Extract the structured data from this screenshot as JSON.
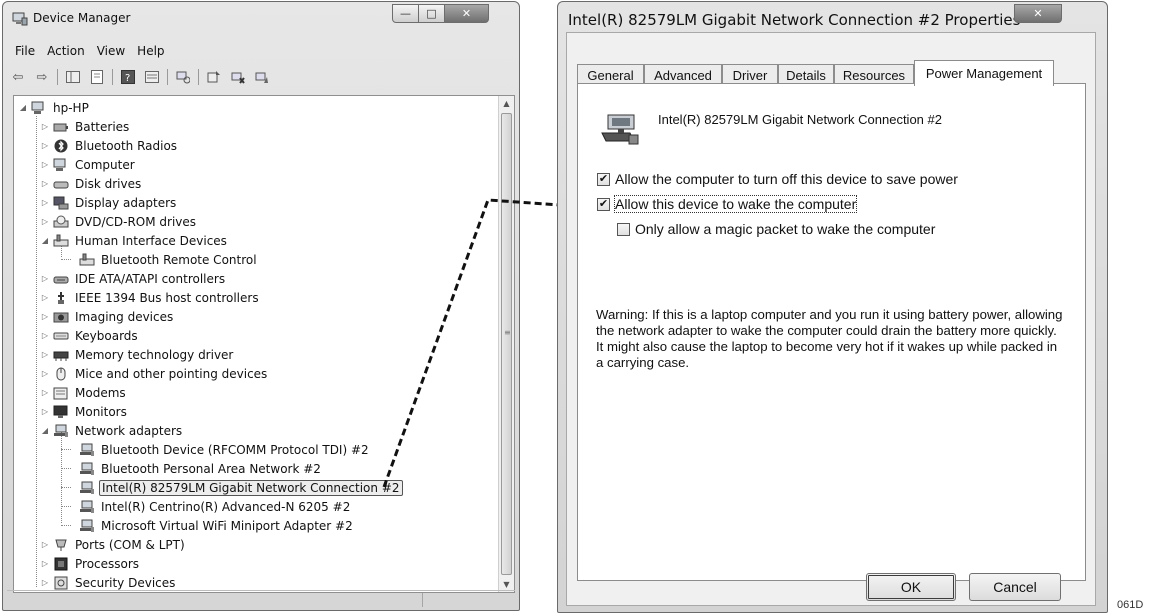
{
  "device_manager": {
    "title": "Device Manager",
    "menu": [
      "File",
      "Action",
      "View",
      "Help"
    ],
    "tree": [
      {
        "label": "hp-HP",
        "icon": "computer-icon",
        "level": 0,
        "expanded": true
      },
      {
        "label": "Batteries",
        "icon": "battery-icon",
        "level": 1,
        "expanded": false
      },
      {
        "label": "Bluetooth Radios",
        "icon": "bluetooth-icon",
        "level": 1,
        "expanded": false
      },
      {
        "label": "Computer",
        "icon": "computer-icon",
        "level": 1,
        "expanded": false
      },
      {
        "label": "Disk drives",
        "icon": "disk-drive-icon",
        "level": 1,
        "expanded": false
      },
      {
        "label": "Display adapters",
        "icon": "display-adapter-icon",
        "level": 1,
        "expanded": false
      },
      {
        "label": "DVD/CD-ROM drives",
        "icon": "dvd-drive-icon",
        "level": 1,
        "expanded": false
      },
      {
        "label": "Human Interface Devices",
        "icon": "hid-icon",
        "level": 1,
        "expanded": true
      },
      {
        "label": "Bluetooth Remote Control",
        "icon": "hid-icon",
        "level": 2
      },
      {
        "label": "IDE ATA/ATAPI controllers",
        "icon": "ide-controller-icon",
        "level": 1,
        "expanded": false
      },
      {
        "label": "IEEE 1394 Bus host controllers",
        "icon": "firewire-icon",
        "level": 1,
        "expanded": false
      },
      {
        "label": "Imaging devices",
        "icon": "camera-icon",
        "level": 1,
        "expanded": false
      },
      {
        "label": "Keyboards",
        "icon": "keyboard-icon",
        "level": 1,
        "expanded": false
      },
      {
        "label": "Memory technology driver",
        "icon": "memory-icon",
        "level": 1,
        "expanded": false
      },
      {
        "label": "Mice and other pointing devices",
        "icon": "mouse-icon",
        "level": 1,
        "expanded": false
      },
      {
        "label": "Modems",
        "icon": "modem-icon",
        "level": 1,
        "expanded": false
      },
      {
        "label": "Monitors",
        "icon": "monitor-icon",
        "level": 1,
        "expanded": false
      },
      {
        "label": "Network adapters",
        "icon": "network-adapter-icon",
        "level": 1,
        "expanded": true
      },
      {
        "label": "Bluetooth Device (RFCOMM Protocol TDI) #2",
        "icon": "network-adapter-icon",
        "level": 2
      },
      {
        "label": "Bluetooth Personal Area Network #2",
        "icon": "network-adapter-icon",
        "level": 2
      },
      {
        "label": "Intel(R) 82579LM Gigabit Network Connection #2",
        "icon": "network-adapter-icon",
        "level": 2,
        "selected": true
      },
      {
        "label": "Intel(R) Centrino(R) Advanced-N 6205 #2",
        "icon": "network-adapter-icon",
        "level": 2
      },
      {
        "label": "Microsoft Virtual WiFi Miniport Adapter #2",
        "icon": "network-adapter-icon",
        "level": 2
      },
      {
        "label": "Ports (COM & LPT)",
        "icon": "port-icon",
        "level": 1,
        "expanded": false
      },
      {
        "label": "Processors",
        "icon": "processor-icon",
        "level": 1,
        "expanded": false
      },
      {
        "label": "Security Devices",
        "icon": "security-device-icon",
        "level": 1,
        "expanded": false
      }
    ]
  },
  "properties_dialog": {
    "title": "Intel(R) 82579LM Gigabit Network Connection #2 Properties",
    "tabs": [
      "General",
      "Advanced",
      "Driver",
      "Details",
      "Resources",
      "Power Management"
    ],
    "active_tab": "Power Management",
    "device_name": "Intel(R) 82579LM Gigabit Network Connection #2",
    "options": [
      {
        "label": "Allow the computer to turn off this device to save power",
        "checked": true
      },
      {
        "label": "Allow this device to wake the computer",
        "checked": true
      },
      {
        "label": "Only allow a magic packet to wake the computer",
        "checked": false
      }
    ],
    "warning": "Warning: If this is a laptop computer and you run it using battery power, allowing the network adapter to wake the computer could drain the battery more quickly. It might also cause the laptop to become very hot if it wakes up while packed in a carrying case.",
    "buttons": {
      "ok": "OK",
      "cancel": "Cancel"
    }
  },
  "figure_code": "061D"
}
